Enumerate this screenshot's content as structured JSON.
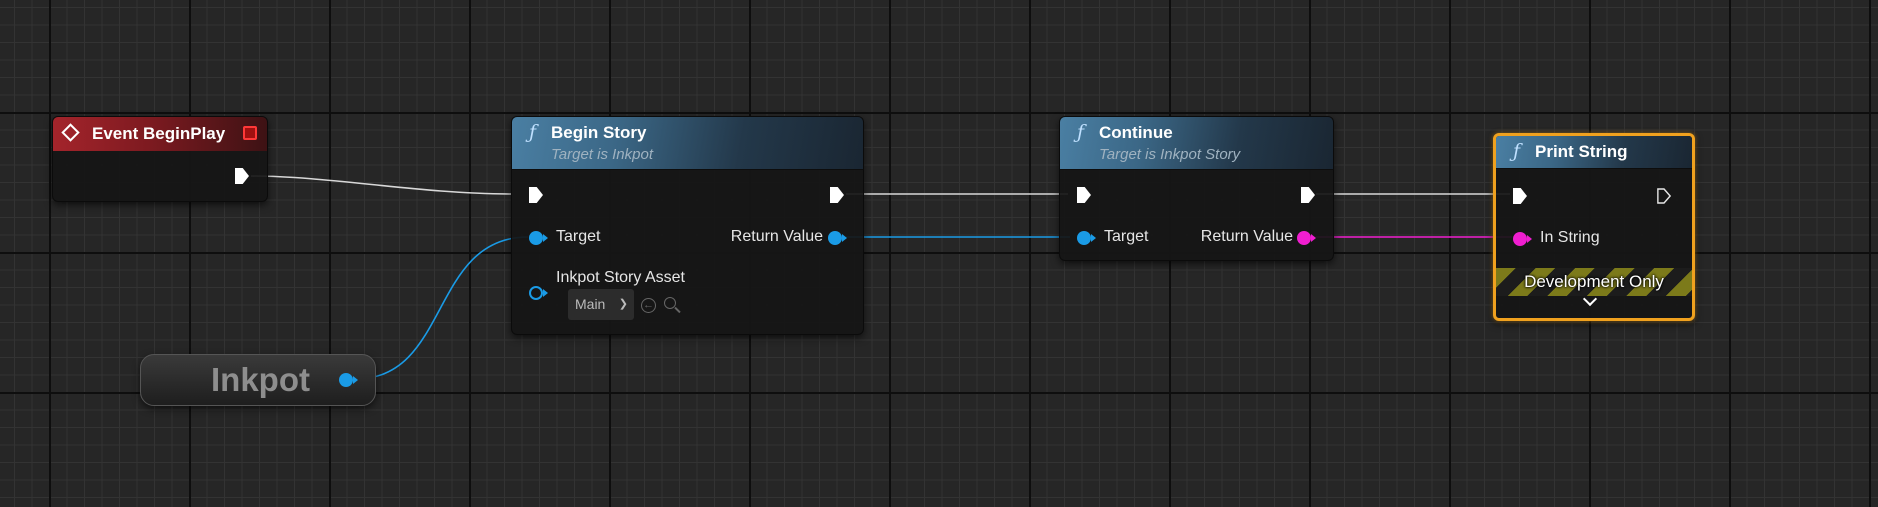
{
  "colors": {
    "exec_wire": "#d8d8d8",
    "object_pin": "#1a9be6",
    "string_pin": "#f01ed0",
    "event_header": "#a4242b",
    "function_header": "#3b6786",
    "selection": "#f0a11e"
  },
  "nodes": {
    "event_begin_play": {
      "title": "Event BeginPlay",
      "icon": "event-diamond-icon"
    },
    "begin_story": {
      "title": "Begin Story",
      "subtitle": "Target is Inkpot",
      "pins": {
        "target": "Target",
        "return_value": "Return Value",
        "story_asset": "Inkpot Story Asset"
      },
      "story_asset_value": "Main"
    },
    "inkpot": {
      "title": "Inkpot"
    },
    "continue": {
      "title": "Continue",
      "subtitle": "Target is Inkpot Story",
      "pins": {
        "target": "Target",
        "return_value": "Return Value"
      }
    },
    "print_string": {
      "title": "Print String",
      "pins": {
        "in_string": "In String"
      },
      "dev_only": "Development Only",
      "selected": true
    }
  },
  "function_glyph": "ƒ"
}
